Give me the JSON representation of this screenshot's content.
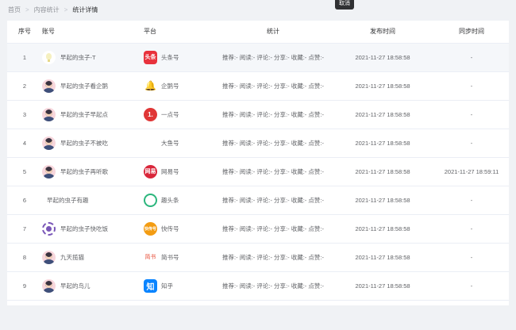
{
  "breadcrumb": {
    "home": "首页",
    "sep": ">",
    "section": "内容统计",
    "current": "统计详情"
  },
  "tooltip": "取消",
  "columns": {
    "index": "序号",
    "account": "账号",
    "platform": "平台",
    "stats": "统计",
    "publish_time": "发布时间",
    "sync_time": "同步时间"
  },
  "rows": [
    {
      "index": "1",
      "avatar": "bulb-avatar",
      "account": "早起的虫子-T",
      "platform_icon": "头条",
      "platform": "头条号",
      "stats": "推荐:-  阅读:-  评论:-  分享:-  收藏:-  点赞:-",
      "publish_time": "2021-11-27 18:58:58",
      "sync_time": "-"
    },
    {
      "index": "2",
      "avatar": "person-avatar",
      "account": "早起的虫子看企鹅",
      "platform_icon": "🔔",
      "platform": "企鹅号",
      "stats": "推荐:-  阅读:-  评论:-  分享:-  收藏:-  点赞:-",
      "publish_time": "2021-11-27 18:58:58",
      "sync_time": "-"
    },
    {
      "index": "3",
      "avatar": "person-avatar",
      "account": "早起的虫子早起点",
      "platform_icon": "1.",
      "platform": "一点号",
      "stats": "推荐:-  阅读:-  评论:-  分享:-  收藏:-  点赞:-",
      "publish_time": "2021-11-27 18:58:58",
      "sync_time": "-"
    },
    {
      "index": "4",
      "avatar": "person-avatar",
      "account": "早起的虫子不被吃",
      "platform_icon": "",
      "platform": "大鱼号",
      "stats": "推荐:-  阅读:-  评论:-  分享:-  收藏:-  点赞:-",
      "publish_time": "2021-11-27 18:58:58",
      "sync_time": "-"
    },
    {
      "index": "5",
      "avatar": "person-avatar",
      "account": "早起的虫子再听歌",
      "platform_icon": "网易",
      "platform": "网易号",
      "stats": "推荐:-  阅读:-  评论:-  分享:-  收藏:-  点赞:-",
      "publish_time": "2021-11-27 18:58:58",
      "sync_time": "2021-11-27 18:59:11"
    },
    {
      "index": "6",
      "avatar": "none",
      "account": "早起的虫子有趣",
      "platform_icon": "",
      "platform": "趣头条",
      "stats": "推荐:-  阅读:-  评论:-  分享:-  收藏:-  点赞:-",
      "publish_time": "2021-11-27 18:58:58",
      "sync_time": "-"
    },
    {
      "index": "7",
      "avatar": "wheel-avatar",
      "account": "早起的虫子快吃饭",
      "platform_icon": "快传号",
      "platform": "快传号",
      "stats": "推荐:-  阅读:-  评论:-  分享:-  收藏:-  点赞:-",
      "publish_time": "2021-11-27 18:58:58",
      "sync_time": "-"
    },
    {
      "index": "8",
      "avatar": "person-avatar",
      "account": "九天揽猫",
      "platform_icon": "简书",
      "platform": "简书号",
      "stats": "推荐:-  阅读:-  评论:-  分享:-  收藏:-  点赞:-",
      "publish_time": "2021-11-27 18:58:58",
      "sync_time": "-"
    },
    {
      "index": "9",
      "avatar": "person-avatar",
      "account": "早起的鸟儿",
      "platform_icon": "知",
      "platform": "知乎",
      "stats": "推荐:-  阅读:-  评论:-  分享:-  收藏:-  点赞:-",
      "publish_time": "2021-11-27 18:58:58",
      "sync_time": "-"
    }
  ],
  "platform_colors": {
    "头条号": "#e8323c",
    "企鹅号": "#f6c343",
    "一点号": "#e03636",
    "大鱼号": "#f08c2e",
    "网易号": "#d9263a",
    "趣头条": "#2cb67d",
    "快传号": "#f39c12",
    "简书号": "#ffffff",
    "知乎": "#0a84ff"
  }
}
